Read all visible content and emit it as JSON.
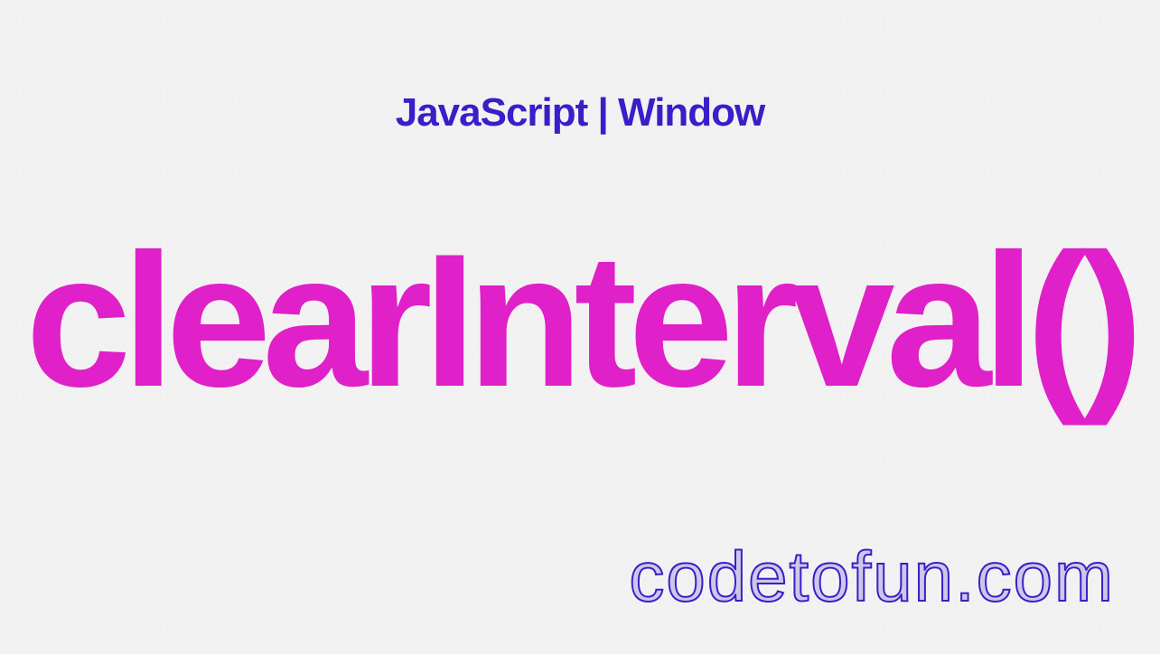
{
  "header": {
    "category": "JavaScript | Window"
  },
  "main": {
    "title": "clearInterval()"
  },
  "footer": {
    "website": "codetofun.com"
  },
  "colors": {
    "header_text": "#3b1dc9",
    "main_title": "#e020c8",
    "footer_text": "#3b1dc9",
    "background": "#f2f2f2"
  }
}
